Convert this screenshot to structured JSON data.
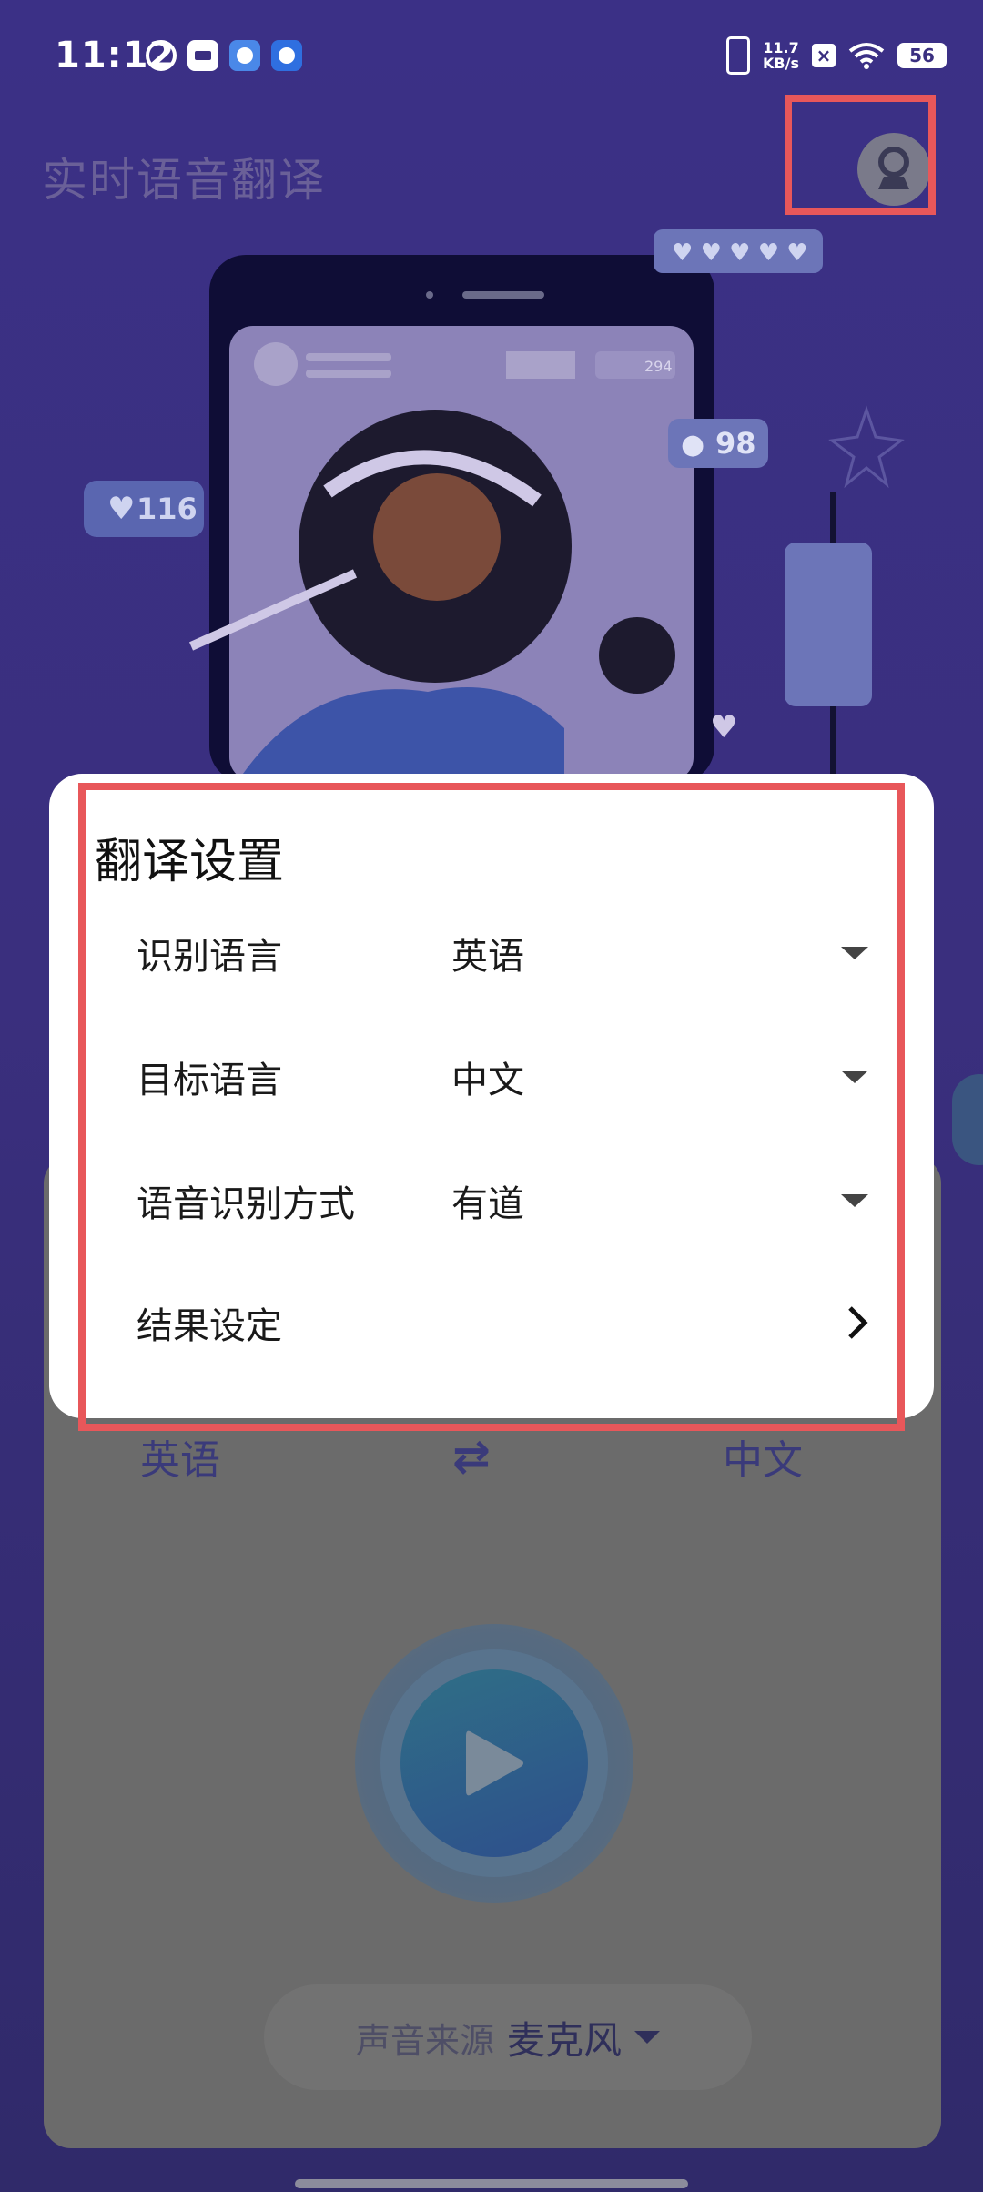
{
  "status_bar": {
    "time": "11:12",
    "network_speed_top": "11.7",
    "network_speed_unit": "KB/s",
    "battery": "56"
  },
  "app": {
    "title": "实时语音翻译",
    "profile_icon": "user-avatar-icon"
  },
  "illustration": {
    "likes": "116",
    "comments": "98",
    "views": "294"
  },
  "dialog": {
    "title": "翻译设置",
    "rows": [
      {
        "label": "识别语言",
        "value": "英语",
        "control": "dropdown"
      },
      {
        "label": "目标语言",
        "value": "中文",
        "control": "dropdown"
      },
      {
        "label": "语音识别方式",
        "value": "有道",
        "control": "dropdown"
      },
      {
        "label": "结果设定",
        "value": "",
        "control": "chevron"
      }
    ]
  },
  "translate_bar": {
    "source_language": "英语",
    "target_language": "中文",
    "swap_icon": "swap-arrows-icon"
  },
  "sound_source": {
    "label": "声音来源",
    "value": "麦克风"
  },
  "colors": {
    "background": "#3a2f80",
    "highlight": "#e8575a",
    "dialog": "#ffffff"
  }
}
